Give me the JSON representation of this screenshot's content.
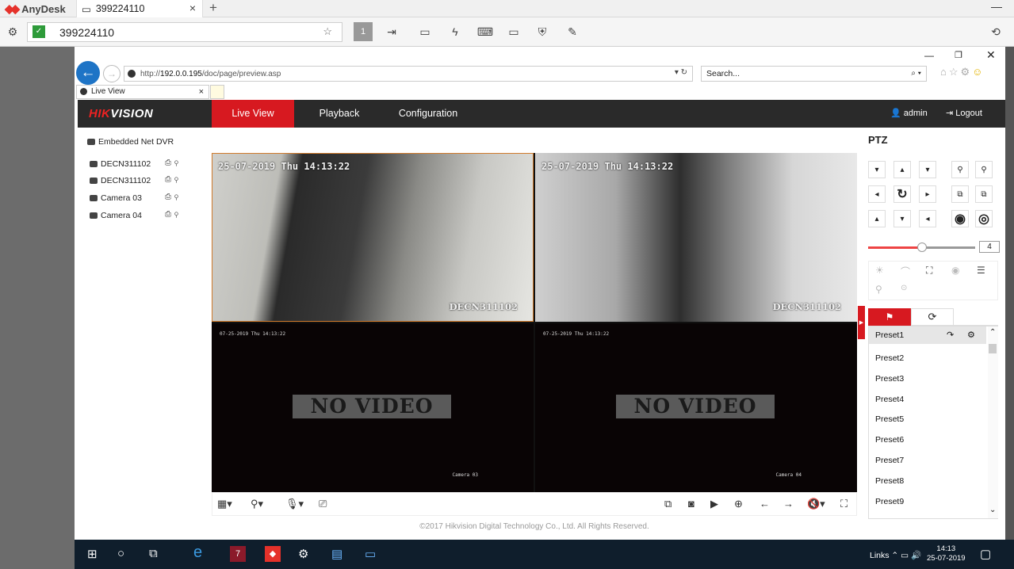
{
  "anydesk": {
    "app_name": "AnyDesk",
    "tab_label": "399224110",
    "address": "399224110",
    "monitor_number": "1"
  },
  "browser": {
    "url_prefix": "http://",
    "url_host": "192.0.0.195",
    "url_path": "/doc/page/preview.asp",
    "search_placeholder": "Search...",
    "tab_title": "Live View"
  },
  "hikvision": {
    "logo_red": "HIK",
    "logo_white": "VISION",
    "nav": [
      "Live View",
      "Playback",
      "Configuration"
    ],
    "active_nav": "Live View",
    "user": "admin",
    "logout": "Logout",
    "device_root": "Embedded Net DVR",
    "cameras": [
      "DECN311102",
      "DECN311102",
      "Camera 03",
      "Camera 04"
    ],
    "copyright": "©2017 Hikvision Digital Technology Co., Ltd. All Rights Reserved."
  },
  "video": {
    "cells": [
      {
        "timestamp": "25-07-2019 Thu 14:13:22",
        "name": "DECN311102"
      },
      {
        "timestamp": "25-07-2019 Thu 14:13:22",
        "name": "DECN311102"
      },
      {
        "timestamp": "07-25-2019 Thu 14:13:22",
        "name": "Camera 03",
        "status": "NO VIDEO"
      },
      {
        "timestamp": "07-25-2019 Thu 14:13:22",
        "name": "Camera 04",
        "status": "NO VIDEO"
      }
    ]
  },
  "ptz": {
    "title": "PTZ",
    "speed": "4",
    "speed_level": 0.5,
    "presets": [
      "Preset1",
      "Preset2",
      "Preset3",
      "Preset4",
      "Preset5",
      "Preset6",
      "Preset7",
      "Preset8",
      "Preset9"
    ]
  },
  "taskbar": {
    "links": "Links",
    "time": "14:13",
    "date": "25-07-2019"
  },
  "colors": {
    "accent": "#d71920",
    "header": "#2a2a2a",
    "taskbar": "#0f1e2c"
  }
}
